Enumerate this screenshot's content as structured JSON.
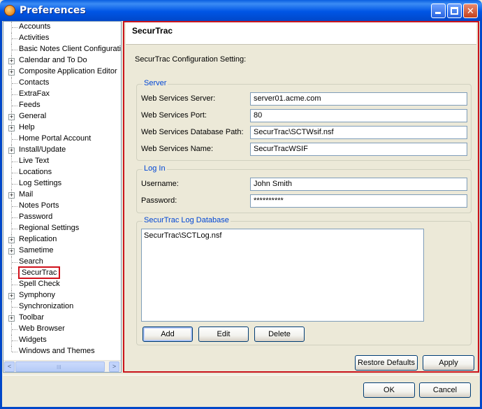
{
  "window": {
    "title": "Preferences",
    "minimize_glyph": "",
    "close_glyph": "✕"
  },
  "tree": {
    "items": [
      {
        "label": "Accounts",
        "expandable": false
      },
      {
        "label": "Activities",
        "expandable": false
      },
      {
        "label": "Basic Notes Client Configuratio",
        "expandable": false
      },
      {
        "label": "Calendar and To Do",
        "expandable": true
      },
      {
        "label": "Composite Application Editor",
        "expandable": true
      },
      {
        "label": "Contacts",
        "expandable": false
      },
      {
        "label": "ExtraFax",
        "expandable": false
      },
      {
        "label": "Feeds",
        "expandable": false
      },
      {
        "label": "General",
        "expandable": true
      },
      {
        "label": "Help",
        "expandable": true
      },
      {
        "label": "Home Portal Account",
        "expandable": false
      },
      {
        "label": "Install/Update",
        "expandable": true
      },
      {
        "label": "Live Text",
        "expandable": false
      },
      {
        "label": "Locations",
        "expandable": false
      },
      {
        "label": "Log Settings",
        "expandable": false
      },
      {
        "label": "Mail",
        "expandable": true
      },
      {
        "label": "Notes Ports",
        "expandable": false
      },
      {
        "label": "Password",
        "expandable": false
      },
      {
        "label": "Regional Settings",
        "expandable": false
      },
      {
        "label": "Replication",
        "expandable": true
      },
      {
        "label": "Sametime",
        "expandable": true
      },
      {
        "label": "Search",
        "expandable": false
      },
      {
        "label": "SecurTrac",
        "expandable": false,
        "selected": true
      },
      {
        "label": "Spell Check",
        "expandable": false
      },
      {
        "label": "Symphony",
        "expandable": true
      },
      {
        "label": "Synchronization",
        "expandable": false
      },
      {
        "label": "Toolbar",
        "expandable": true
      },
      {
        "label": "Web Browser",
        "expandable": false
      },
      {
        "label": "Widgets",
        "expandable": false
      },
      {
        "label": "Windows and Themes",
        "expandable": false
      }
    ],
    "scroll_left": "<",
    "scroll_right": ">",
    "scroll_grip": "III"
  },
  "page": {
    "title": "SecurTrac",
    "config_label": "SecurTrac Configuration Setting:",
    "server": {
      "legend": "Server",
      "ws_server_label": "Web Services Server:",
      "ws_server_value": "server01.acme.com",
      "ws_port_label": "Web Services Port:",
      "ws_port_value": "80",
      "ws_db_path_label": "Web Services Database Path:",
      "ws_db_path_value": "SecurTrac\\SCTWsif.nsf",
      "ws_name_label": "Web Services Name:",
      "ws_name_value": "SecurTracWSIF"
    },
    "login": {
      "legend": "Log In",
      "username_label": "Username:",
      "username_value": "John Smith",
      "password_label": "Password:",
      "password_value": "**********"
    },
    "logdb": {
      "legend": "SecurTrac Log Database",
      "entries": "SecurTrac\\SCTLog.nsf",
      "add_label": "Add",
      "edit_label": "Edit",
      "delete_label": "Delete"
    },
    "restore_defaults_label": "Restore Defaults",
    "apply_label": "Apply"
  },
  "dialog": {
    "ok_label": "OK",
    "cancel_label": "Cancel"
  }
}
